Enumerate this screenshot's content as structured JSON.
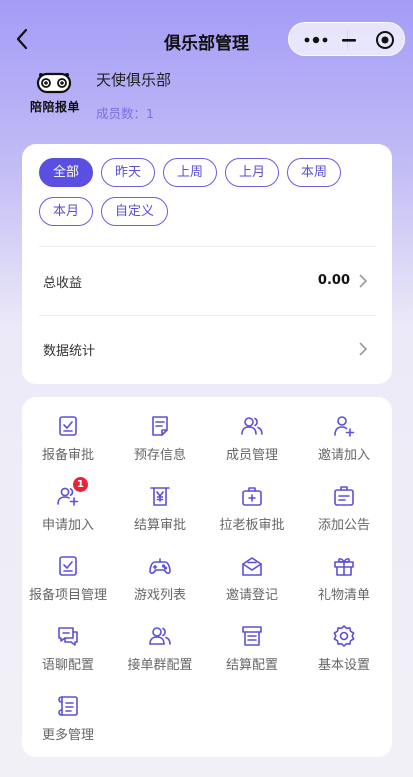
{
  "nav": {
    "title": "俱乐部管理"
  },
  "club": {
    "name": "天使俱乐部",
    "member_label": "成员数：",
    "member_count": "1",
    "logo_text": "陪陪报单"
  },
  "filters": [
    "全部",
    "昨天",
    "上周",
    "上月",
    "本周",
    "本月",
    "自定义"
  ],
  "active_filter": "全部",
  "revenue": {
    "label": "总收益",
    "value": "0.00"
  },
  "stats": {
    "label": "数据统计"
  },
  "menu": [
    {
      "label": "报备审批",
      "icon": "clipboard-check-icon"
    },
    {
      "label": "预存信息",
      "icon": "document-icon"
    },
    {
      "label": "成员管理",
      "icon": "users-icon"
    },
    {
      "label": "邀请加入",
      "icon": "user-plus-icon"
    },
    {
      "label": "申请加入",
      "icon": "users-plus-icon",
      "badge": "1"
    },
    {
      "label": "结算审批",
      "icon": "receipt-yen-icon"
    },
    {
      "label": "拉老板审批",
      "icon": "medical-kit-icon"
    },
    {
      "label": "添加公告",
      "icon": "announcement-icon"
    },
    {
      "label": "报备项目管理",
      "icon": "clipboard-list-icon"
    },
    {
      "label": "游戏列表",
      "icon": "gamepad-icon"
    },
    {
      "label": "邀请登记",
      "icon": "envelope-icon"
    },
    {
      "label": "礼物清单",
      "icon": "gift-icon"
    },
    {
      "label": "语聊配置",
      "icon": "chat-icon"
    },
    {
      "label": "接单群配置",
      "icon": "group-icon"
    },
    {
      "label": "结算配置",
      "icon": "archive-icon"
    },
    {
      "label": "基本设置",
      "icon": "gear-icon"
    },
    {
      "label": "更多管理",
      "icon": "scroll-icon"
    }
  ],
  "colors": {
    "accent": "#5a4fe0",
    "icon": "#5b50d8",
    "badge": "#e8243c"
  }
}
